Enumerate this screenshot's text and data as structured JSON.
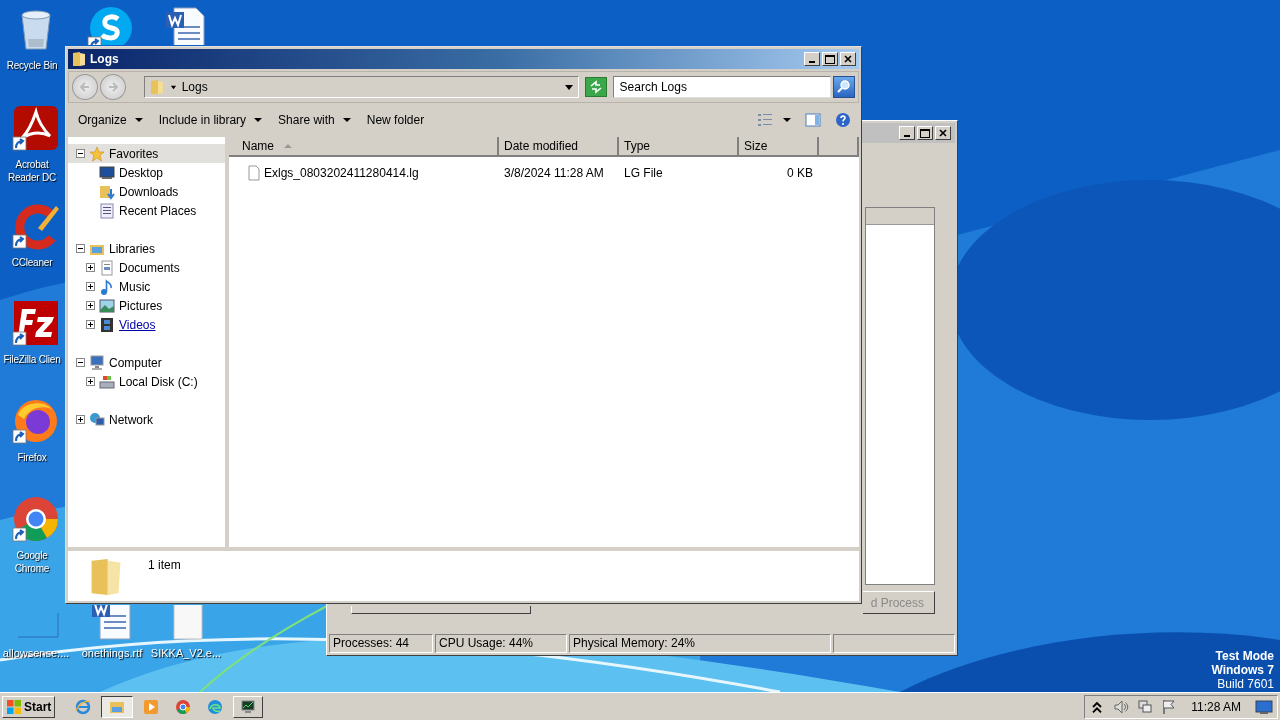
{
  "desktop_icons": [
    {
      "kind": "bin",
      "label": "Recycle Bin",
      "shortcut": false
    },
    {
      "kind": "acrobat",
      "label": "Acrobat Reader DC",
      "shortcut": true
    },
    {
      "kind": "ccleaner",
      "label": "CCleaner",
      "shortcut": true
    },
    {
      "kind": "filezilla",
      "label": "FileZilla Clien",
      "shortcut": true
    },
    {
      "kind": "firefox",
      "label": "Firefox",
      "shortcut": true
    },
    {
      "kind": "chrome",
      "label": "Google Chrome",
      "shortcut": true
    },
    {
      "kind": "skype",
      "shortcut": true
    },
    {
      "kind": "word",
      "shortcut": false
    },
    {
      "kind": "blank",
      "label": "allowsense....",
      "shortcut": false
    },
    {
      "kind": "word",
      "label": "onethings.rtf",
      "shortcut": false
    },
    {
      "kind": "file",
      "label": "SIKKA_V2.e...",
      "shortcut": false
    }
  ],
  "background_window": {
    "button": "d Process",
    "button_disabled": true,
    "status": [
      "Processes: 44",
      "CPU Usage: 44%",
      "Physical Memory: 24%"
    ]
  },
  "explorer": {
    "title": "Logs",
    "breadcrumb": "Logs",
    "search": {
      "placeholder": "Search Logs"
    },
    "toolbar": [
      {
        "label": "Organize",
        "dropdown": true
      },
      {
        "label": "Include in library",
        "dropdown": true
      },
      {
        "label": "Share with",
        "dropdown": true
      },
      {
        "label": "New folder",
        "dropdown": false
      }
    ],
    "nav": [
      {
        "kind": "favorites",
        "label": "Favorites",
        "expanded": true,
        "selected": true,
        "children": [
          {
            "kind": "desktop",
            "label": "Desktop",
            "hovered": false
          },
          {
            "kind": "downloads",
            "label": "Downloads",
            "hovered": false
          },
          {
            "kind": "recent",
            "label": "Recent Places",
            "hovered": false
          }
        ]
      },
      {
        "kind": "libraries",
        "label": "Libraries",
        "expanded": true,
        "selected": false,
        "children": [
          {
            "kind": "documents",
            "label": "Documents",
            "expanded": false,
            "hovered": false
          },
          {
            "kind": "music",
            "label": "Music",
            "expanded": false,
            "hovered": false
          },
          {
            "kind": "pictures",
            "label": "Pictures",
            "expanded": false,
            "hovered": false
          },
          {
            "kind": "videos",
            "label": "Videos",
            "expanded": false,
            "hovered": true
          }
        ]
      },
      {
        "kind": "computer",
        "label": "Computer",
        "expanded": true,
        "selected": false,
        "children": [
          {
            "kind": "disk",
            "label": "Local Disk (C:)",
            "expanded": false,
            "hovered": false
          }
        ]
      },
      {
        "kind": "network",
        "label": "Network",
        "expanded": false,
        "selected": false
      }
    ],
    "columns": [
      {
        "label": "Name",
        "sorted": true
      },
      {
        "label": "Date modified",
        "sorted": false
      },
      {
        "label": "Type",
        "sorted": false
      },
      {
        "label": "Size",
        "sorted": false
      }
    ],
    "rows": [
      {
        "selected": false,
        "cells": [
          "Exlgs_0803202411280414.lg",
          "3/8/2024 11:28 AM",
          "LG File",
          "0 KB"
        ]
      }
    ],
    "details": "1 item"
  },
  "taskbar": {
    "start": "Start",
    "apps": [
      {
        "kind": "ie",
        "active": false
      },
      {
        "kind": "explorer",
        "active": true
      },
      {
        "kind": "media",
        "active": false
      },
      {
        "kind": "chrome",
        "active": false
      },
      {
        "kind": "edge",
        "active": false
      },
      {
        "kind": "taskmgr",
        "active": false
      }
    ],
    "clock": "11:28 AM"
  },
  "watermark_os": {
    "mode": "Test Mode",
    "os": "Windows 7",
    "build": "Build 7601"
  }
}
